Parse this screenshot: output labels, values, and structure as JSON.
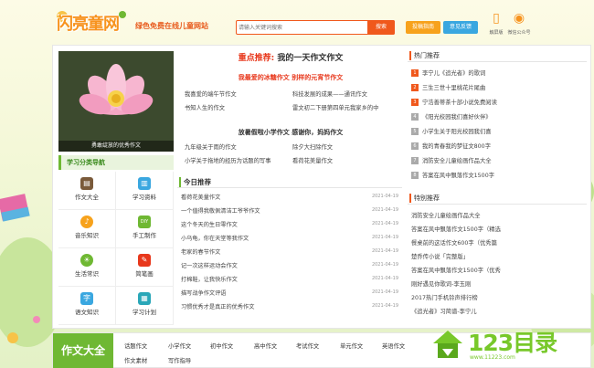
{
  "header": {
    "logo_text": "闪亮童网",
    "slogan": "绿色免费在线儿童网站",
    "search_placeholder": "请输入关键词搜索",
    "search_button": "搜索",
    "btn_contribute": "投稿指南",
    "btn_feedback": "意见反馈",
    "mobile_label": "触屏版",
    "wechat_label": "微信公众号"
  },
  "feature": {
    "caption": "勇敢绽放的优秀作文"
  },
  "categories": {
    "title": "学习分类导航",
    "items": [
      {
        "label": "作文大全",
        "icon": "book-icon",
        "color": "#7a5a3a"
      },
      {
        "label": "学习资料",
        "icon": "books-icon",
        "color": "#3aa7e0"
      },
      {
        "label": "音乐知识",
        "icon": "music-icon",
        "color": "#f7a21c"
      },
      {
        "label": "手工制作",
        "icon": "diy-icon",
        "color": "#6fb833"
      },
      {
        "label": "生活常识",
        "icon": "sun-icon",
        "color": "#6fb833"
      },
      {
        "label": "简笔画",
        "icon": "drawing-icon",
        "color": "#e8381c"
      },
      {
        "label": "语文知识",
        "icon": "dictionary-icon",
        "color": "#3aa7e0"
      },
      {
        "label": "学习计划",
        "icon": "calendar-icon",
        "color": "#2aa7b8"
      }
    ]
  },
  "recommend": {
    "title_red": "重点推荐:",
    "title_main": "我的一天作文作文",
    "sub1": "我最爱的冰糖作文  别样的元宵节作文",
    "links1": [
      "我喜爱的端午节作文",
      "科技发展的成果——通讯作文",
      "书知人生的作文",
      "雷文初二下册第四单元我家乡的中"
    ],
    "sub2": "放暑假啦小学作文  感谢你，妈妈作文",
    "links2": [
      "九年级关于雨的作文",
      "除夕大扫除作文",
      "小学关于拖地的经历为话题的写事",
      "看荷花美量作文"
    ]
  },
  "today": {
    "title": "今日推荐",
    "rows": [
      {
        "title": "看荷花美量作文",
        "date": "2021-04-19"
      },
      {
        "title": "一个值得我敬佩清洁工爷爷作文",
        "date": "2021-04-19"
      },
      {
        "title": "这个冬天的生日零作文",
        "date": "2021-04-19"
      },
      {
        "title": "小乌龟，你在天堂等我作文",
        "date": "2021-04-19"
      },
      {
        "title": "老家的春节作文",
        "date": "2021-04-19"
      },
      {
        "title": "记一次这样运动会作文",
        "date": "2021-04-19"
      },
      {
        "title": "打棉鞋，让我快乐作文",
        "date": "2021-04-19"
      },
      {
        "title": "描写战争作文评语",
        "date": "2021-04-19"
      },
      {
        "title": "习惯优秀才是真正的优秀作文",
        "date": "2021-04-19"
      }
    ]
  },
  "hot": {
    "title": "热门推荐",
    "items": [
      {
        "num": "1",
        "title": "李宁儿《追光者》的歌词"
      },
      {
        "num": "2",
        "title": "三生三世十里桃花片尾曲"
      },
      {
        "num": "3",
        "title": "宁浩善蒂茶十部小说免费阅读"
      },
      {
        "num": "4",
        "title": "《阳光校园我们喜好伙伴》"
      },
      {
        "num": "5",
        "title": "小学生关于阳光校园我们喜"
      },
      {
        "num": "6",
        "title": "我的青春我的梦征文800字"
      },
      {
        "num": "7",
        "title": "消防安全儿童绘画作品大全"
      },
      {
        "num": "8",
        "title": "答案在风中飘落作文1500字"
      }
    ]
  },
  "special": {
    "title": "特别推荐",
    "items": [
      "消防安全儿童绘画作品大全",
      "答案在风中飘落作文1500字（精选",
      "餐桌前的这话作文600字（优秀篇",
      "楚乔传小说「完整版」",
      "答案在风中飘落作文1500字（优秀",
      "刚好遇见你歌词-李玉刚",
      "2017热门手机铃声排行榜",
      "《追光者》习简谱-李宁儿"
    ]
  },
  "bottom": {
    "title": "作文大全",
    "row1": [
      "话题作文",
      "小学作文",
      "初中作文",
      "高中作文",
      "考试作文",
      "单元作文",
      "英语作文"
    ],
    "row2": [
      "作文素材",
      "写作指导"
    ]
  },
  "watermark": {
    "number": "123目录",
    "url": "www.11223.com"
  }
}
